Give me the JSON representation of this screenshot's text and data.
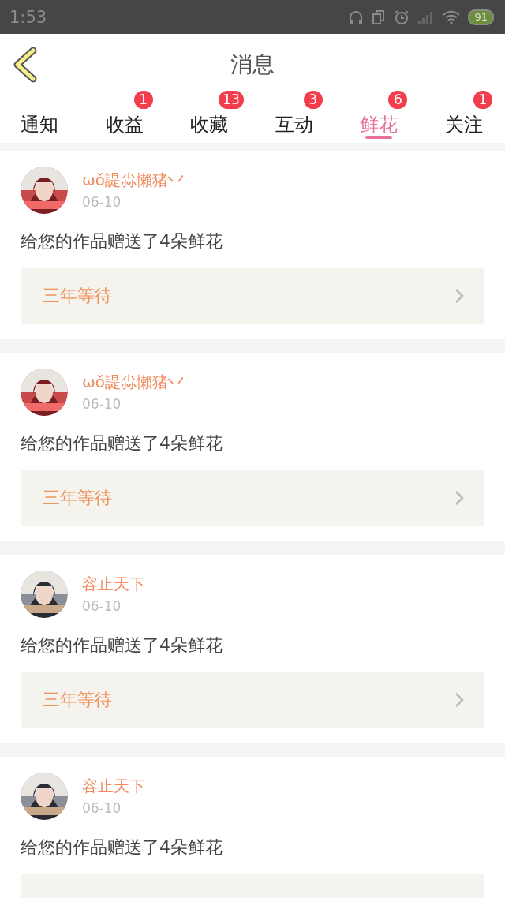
{
  "status_bar": {
    "time": "1:53",
    "battery": "91"
  },
  "header": {
    "title": "消息"
  },
  "tabs": [
    {
      "label": "通知",
      "selected": false
    },
    {
      "label": "收益",
      "badge": "1",
      "selected": false
    },
    {
      "label": "收藏",
      "badge": "13",
      "selected": false
    },
    {
      "label": "互动",
      "badge": "3",
      "selected": false
    },
    {
      "label": "鲜花",
      "badge": "6",
      "selected": true
    },
    {
      "label": "关注",
      "badge": "1",
      "selected": false
    }
  ],
  "messages": [
    {
      "name": "ωǒ諟尛懶猪丷",
      "date": "06-10",
      "text": "给您的作品赠送了4朵鲜花",
      "work": "三年等待"
    },
    {
      "name": "ωǒ諟尛懶猪丷",
      "date": "06-10",
      "text": "给您的作品赠送了4朵鲜花",
      "work": "三年等待"
    },
    {
      "name": "容止天下",
      "date": "06-10",
      "text": "给您的作品赠送了4朵鲜花",
      "work": "三年等待"
    },
    {
      "name": "容止天下",
      "date": "06-10",
      "text": "给您的作品赠送了4朵鲜花"
    }
  ]
}
